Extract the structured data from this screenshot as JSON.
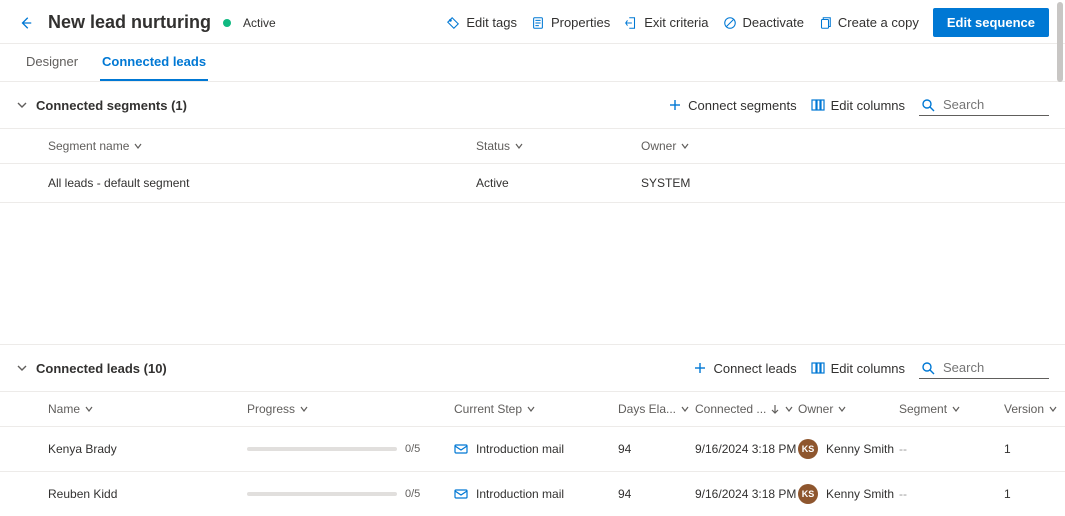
{
  "header": {
    "title": "New lead nurturing",
    "status": "Active"
  },
  "commands": {
    "edit_tags": "Edit tags",
    "properties": "Properties",
    "exit_criteria": "Exit criteria",
    "deactivate": "Deactivate",
    "create_copy": "Create a copy",
    "edit_sequence": "Edit sequence"
  },
  "tabs": {
    "designer": "Designer",
    "connected_leads": "Connected leads"
  },
  "segments_section": {
    "title": "Connected segments (1)",
    "connect_action": "Connect segments",
    "edit_columns": "Edit columns",
    "search_placeholder": "Search",
    "columns": {
      "segment_name": "Segment name",
      "status": "Status",
      "owner": "Owner"
    },
    "rows": [
      {
        "name": "All leads - default segment",
        "status": "Active",
        "owner": "SYSTEM"
      }
    ]
  },
  "leads_section": {
    "title": "Connected leads (10)",
    "connect_action": "Connect leads",
    "edit_columns": "Edit columns",
    "search_placeholder": "Search",
    "columns": {
      "name": "Name",
      "progress": "Progress",
      "current_step": "Current Step",
      "days_elapsed": "Days Ela...",
      "connected": "Connected ...",
      "owner": "Owner",
      "segment": "Segment",
      "version": "Version"
    },
    "rows": [
      {
        "name": "Kenya Brady",
        "progress_text": "0/5",
        "current_step": "Introduction mail",
        "days_elapsed": "94",
        "connected": "9/16/2024 3:18 PM",
        "owner_initials": "KS",
        "owner_name": "Kenny Smith",
        "segment": "--",
        "version": "1"
      },
      {
        "name": "Reuben Kidd",
        "progress_text": "0/5",
        "current_step": "Introduction mail",
        "days_elapsed": "94",
        "connected": "9/16/2024 3:18 PM",
        "owner_initials": "KS",
        "owner_name": "Kenny Smith",
        "segment": "--",
        "version": "1"
      }
    ]
  }
}
